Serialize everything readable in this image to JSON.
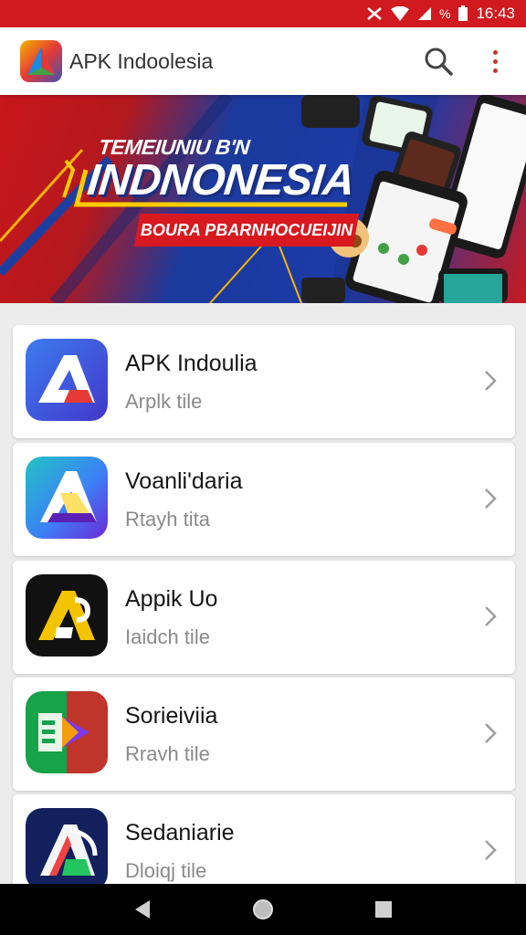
{
  "status_bar": {
    "battery": "%",
    "time": "16:43"
  },
  "app_bar": {
    "title": "APK Indoolesia"
  },
  "banner": {
    "line1": "TEMEIUNIU B'N",
    "line2": "INDNONESIA",
    "line3": "BOURA PBARNHOCUEIJIN"
  },
  "apps": [
    {
      "title": "APK Indoulia",
      "subtitle": "Arplk tile",
      "icon": "apk-a-blue-icon"
    },
    {
      "title": "Voanli'daria",
      "subtitle": "Rtayh tita",
      "icon": "apk-a-teal-icon"
    },
    {
      "title": "Appik Uo",
      "subtitle": "Iaidch tile",
      "icon": "apk-a-yellow-icon"
    },
    {
      "title": "Sorieiviia",
      "subtitle": "Rravh tile",
      "icon": "green-red-play-icon"
    },
    {
      "title": "Sedaniarie",
      "subtitle": "Dloiqj tile",
      "icon": "apk-a-navy-icon"
    }
  ],
  "colors": {
    "status_red": "#d01a1f",
    "card_bg": "#ffffff",
    "page_bg": "#ececec"
  }
}
